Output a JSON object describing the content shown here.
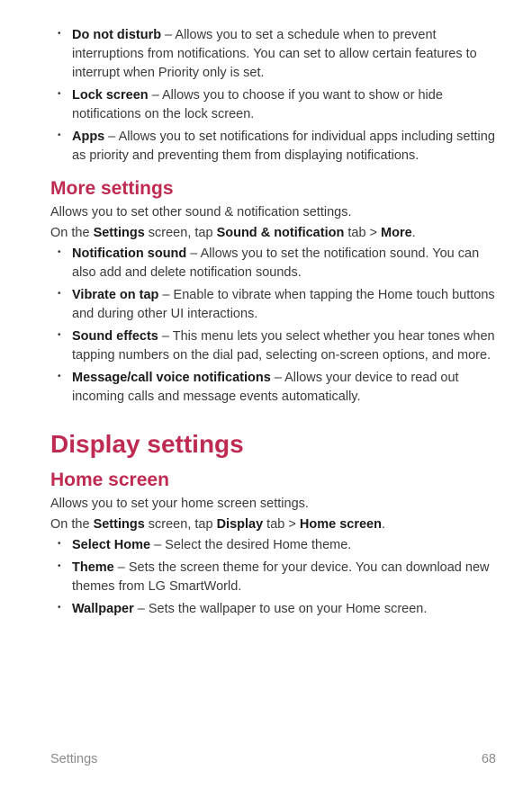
{
  "top_list": [
    {
      "term": "Do not disturb",
      "desc": " – Allows you to set a schedule when to prevent interruptions from notifications. You can set to allow certain features to interrupt when Priority only is set."
    },
    {
      "term": "Lock screen",
      "desc": " – Allows you to choose if you want to show or hide notifications on the lock screen."
    },
    {
      "term": "Apps",
      "desc": " – Allows you to set notifications for individual apps including setting as priority and preventing them from displaying notifications."
    }
  ],
  "more_settings": {
    "heading": "More settings",
    "intro": "Allows you to set other sound & notification settings.",
    "path_pre": "On the ",
    "path_b1": "Settings",
    "path_mid1": " screen, tap ",
    "path_b2": "Sound & notification",
    "path_mid2": " tab > ",
    "path_b3": "More",
    "path_end": ".",
    "items": [
      {
        "term": "Notification sound",
        "desc": " – Allows you to set the notification sound. You can also add and delete notification sounds."
      },
      {
        "term": "Vibrate on tap",
        "desc": " – Enable to vibrate when tapping the Home touch buttons and during other UI interactions."
      },
      {
        "term": "Sound effects",
        "desc": " – This menu lets you select whether you hear tones when tapping numbers on the dial pad, selecting on-screen options, and more."
      },
      {
        "term": "Message/call voice notifications",
        "desc": " – Allows your device to read out incoming calls and message events automatically."
      }
    ]
  },
  "display_settings": {
    "heading": "Display settings"
  },
  "home_screen": {
    "heading": "Home screen",
    "intro": "Allows you to set your home screen settings.",
    "path_pre": "On the ",
    "path_b1": "Settings",
    "path_mid1": " screen, tap ",
    "path_b2": "Display",
    "path_mid2": " tab > ",
    "path_b3": "Home screen",
    "path_end": ".",
    "items": [
      {
        "term": "Select Home",
        "desc": " – Select the desired Home theme."
      },
      {
        "term": "Theme",
        "desc": " – Sets the screen theme for your device. You can download new themes from LG SmartWorld."
      },
      {
        "term": "Wallpaper",
        "desc": " – Sets the wallpaper to use on your Home screen."
      }
    ]
  },
  "footer": {
    "section": "Settings",
    "page": "68"
  }
}
